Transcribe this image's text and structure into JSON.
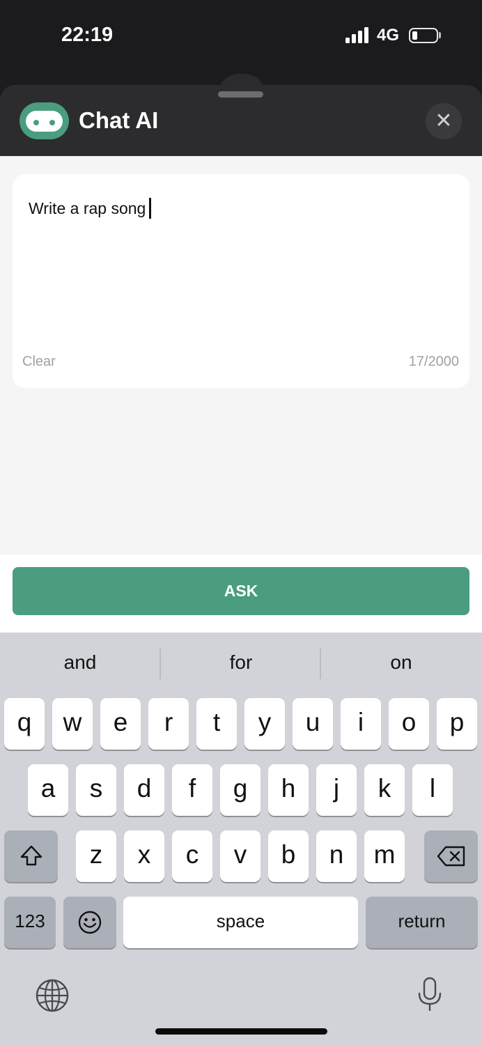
{
  "status_bar": {
    "time": "22:19",
    "network": "4G"
  },
  "header": {
    "title": "Chat AI"
  },
  "prompt": {
    "text": "Write a rap song",
    "clear_label": "Clear",
    "char_count": "17/2000"
  },
  "ask_button": {
    "label": "ASK"
  },
  "keyboard": {
    "suggestions": [
      "and",
      "for",
      "on"
    ],
    "row1": [
      "q",
      "w",
      "e",
      "r",
      "t",
      "y",
      "u",
      "i",
      "o",
      "p"
    ],
    "row2": [
      "a",
      "s",
      "d",
      "f",
      "g",
      "h",
      "j",
      "k",
      "l"
    ],
    "row3": [
      "z",
      "x",
      "c",
      "v",
      "b",
      "n",
      "m"
    ],
    "numbers_label": "123",
    "space_label": "space",
    "return_label": "return"
  },
  "colors": {
    "accent": "#4a9d7f",
    "header_bg": "#2c2c2e",
    "keyboard_bg": "#d1d3d8"
  },
  "icons": [
    "signal-icon",
    "battery-icon",
    "robot-logo-icon",
    "close-icon",
    "shift-icon",
    "delete-icon",
    "emoji-icon",
    "globe-icon",
    "microphone-icon"
  ]
}
